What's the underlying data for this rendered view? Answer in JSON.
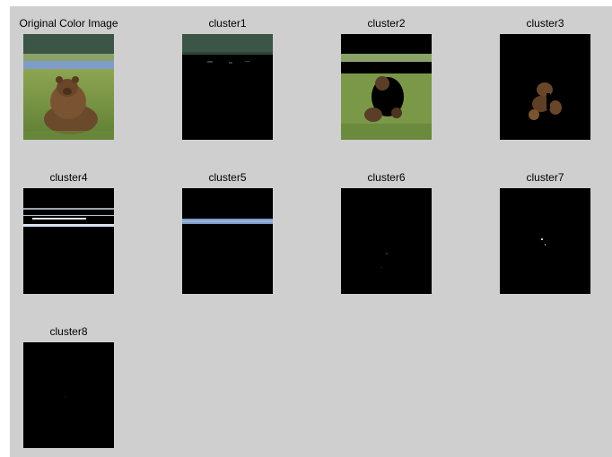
{
  "figure": {
    "background": "#cfcfcf",
    "panels": [
      {
        "title": "Original Color Image"
      },
      {
        "title": "cluster1"
      },
      {
        "title": "cluster2"
      },
      {
        "title": "cluster3"
      },
      {
        "title": "cluster4"
      },
      {
        "title": "cluster5"
      },
      {
        "title": "cluster6"
      },
      {
        "title": "cluster7"
      },
      {
        "title": "cluster8"
      }
    ]
  }
}
